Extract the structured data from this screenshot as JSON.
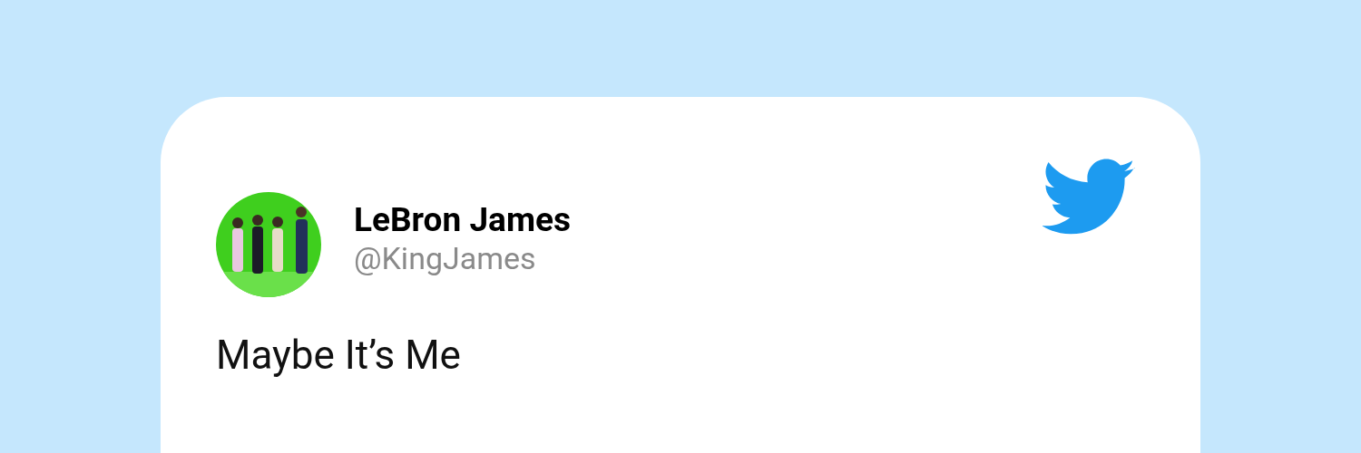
{
  "tweet": {
    "author": {
      "name": "LeBron James",
      "handle": "@KingJames"
    },
    "text": "Maybe It’s Me"
  }
}
